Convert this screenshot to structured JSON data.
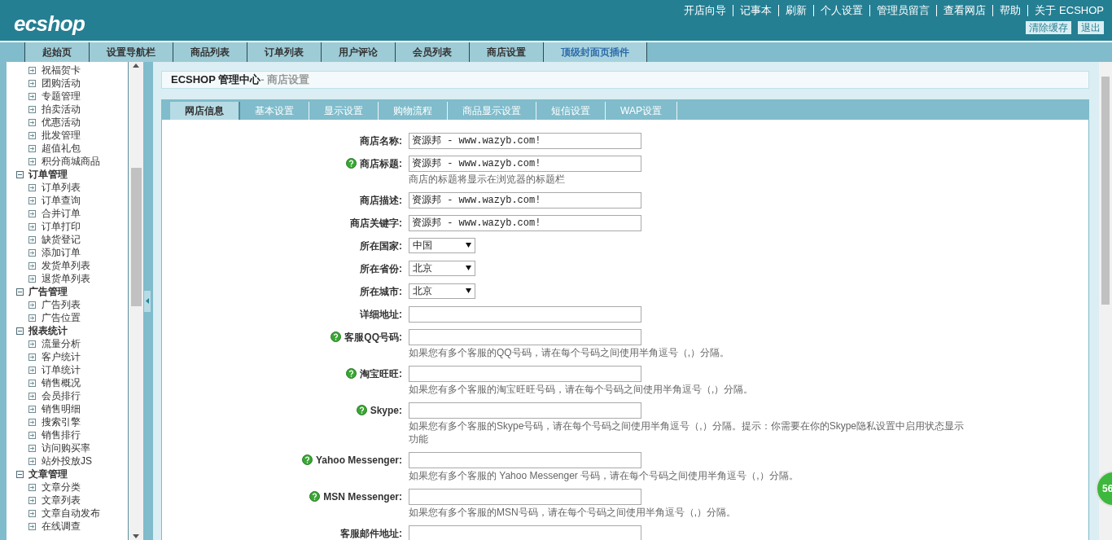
{
  "header": {
    "logo": "ecshop",
    "links": [
      "开店向导",
      "记事本",
      "刷新",
      "个人设置",
      "管理员留言",
      "查看网店",
      "帮助",
      "关于 ECSHOP"
    ],
    "buttons": [
      "清除缓存",
      "退出"
    ]
  },
  "nav": [
    {
      "label": "起始页",
      "selected": false
    },
    {
      "label": "设置导航栏",
      "selected": false
    },
    {
      "label": "商品列表",
      "selected": false
    },
    {
      "label": "订单列表",
      "selected": false
    },
    {
      "label": "用户评论",
      "selected": false
    },
    {
      "label": "会员列表",
      "selected": false
    },
    {
      "label": "商店设置",
      "selected": false
    },
    {
      "label": "顶级封面页插件",
      "selected": true
    }
  ],
  "sidebar": {
    "leading_items": [
      "祝福贺卡",
      "团购活动",
      "专题管理",
      "拍卖活动",
      "优惠活动",
      "批发管理",
      "超值礼包",
      "积分商城商品"
    ],
    "groups": [
      {
        "label": "订单管理",
        "expanded": true,
        "children": [
          "订单列表",
          "订单查询",
          "合并订单",
          "订单打印",
          "缺货登记",
          "添加订单",
          "发货单列表",
          "退货单列表"
        ]
      },
      {
        "label": "广告管理",
        "expanded": true,
        "children": [
          "广告列表",
          "广告位置"
        ]
      },
      {
        "label": "报表统计",
        "expanded": true,
        "children": [
          "流量分析",
          "客户统计",
          "订单统计",
          "销售概况",
          "会员排行",
          "销售明细",
          "搜索引擎",
          "销售排行",
          "访问购买率",
          "站外投放JS"
        ]
      },
      {
        "label": "文章管理",
        "expanded": true,
        "children": [
          "文章分类",
          "文章列表",
          "文章自动发布",
          "在线调查"
        ]
      }
    ]
  },
  "page_title": {
    "main": "ECSHOP 管理中心",
    "sub": "- 商店设置"
  },
  "tabs": [
    {
      "label": "网店信息",
      "selected": true
    },
    {
      "label": "基本设置",
      "selected": false
    },
    {
      "label": "显示设置",
      "selected": false
    },
    {
      "label": "购物流程",
      "selected": false
    },
    {
      "label": "商品显示设置",
      "selected": false
    },
    {
      "label": "短信设置",
      "selected": false
    },
    {
      "label": "WAP设置",
      "selected": false
    }
  ],
  "form": [
    {
      "kind": "text",
      "label": "商店名称:",
      "help": false,
      "value": "资源邦 - www.wazyb.com!"
    },
    {
      "kind": "text",
      "label": "商店标题:",
      "help": true,
      "value": "资源邦 - www.wazyb.com!",
      "hint": "商店的标题将显示在浏览器的标题栏"
    },
    {
      "kind": "text",
      "label": "商店描述:",
      "help": false,
      "value": "资源邦 - www.wazyb.com!"
    },
    {
      "kind": "text",
      "label": "商店关键字:",
      "help": false,
      "value": "资源邦 - www.wazyb.com!"
    },
    {
      "kind": "select",
      "label": "所在国家:",
      "help": false,
      "value": "中国"
    },
    {
      "kind": "select",
      "label": "所在省份:",
      "help": false,
      "value": "北京"
    },
    {
      "kind": "select",
      "label": "所在城市:",
      "help": false,
      "value": "北京"
    },
    {
      "kind": "text",
      "label": "详细地址:",
      "help": false
    },
    {
      "kind": "text",
      "label": "客服QQ号码:",
      "help": true,
      "hint": "如果您有多个客服的QQ号码，请在每个号码之间使用半角逗号（,）分隔。"
    },
    {
      "kind": "text",
      "label": "淘宝旺旺:",
      "help": true,
      "hint": "如果您有多个客服的淘宝旺旺号码，请在每个号码之间使用半角逗号（,）分隔。"
    },
    {
      "kind": "text",
      "label": "Skype:",
      "help": true,
      "hint": "如果您有多个客服的Skype号码，请在每个号码之间使用半角逗号（,）分隔。提示：你需要在你的Skype隐私设置中启用状态显示功能"
    },
    {
      "kind": "text",
      "label": "Yahoo Messenger:",
      "help": true,
      "hint": "如果您有多个客服的 Yahoo Messenger 号码，请在每个号码之间使用半角逗号（,）分隔。"
    },
    {
      "kind": "text",
      "label": "MSN Messenger:",
      "help": true,
      "hint": "如果您有多个客服的MSN号码，请在每个号码之间使用半角逗号（,）分隔。"
    },
    {
      "kind": "text",
      "label": "客服邮件地址:",
      "help": false
    }
  ],
  "floating_badge": "56"
}
